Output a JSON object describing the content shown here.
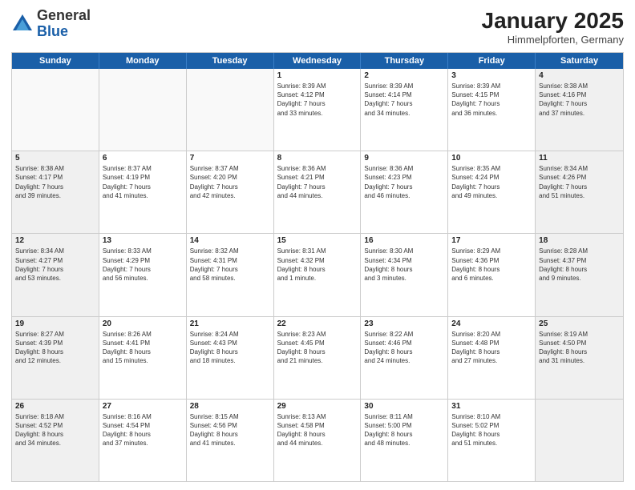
{
  "header": {
    "logo": {
      "general": "General",
      "blue": "Blue"
    },
    "title": "January 2025",
    "location": "Himmelpforten, Germany"
  },
  "weekdays": [
    "Sunday",
    "Monday",
    "Tuesday",
    "Wednesday",
    "Thursday",
    "Friday",
    "Saturday"
  ],
  "rows": [
    [
      {
        "day": "",
        "text": "",
        "empty": true
      },
      {
        "day": "",
        "text": "",
        "empty": true
      },
      {
        "day": "",
        "text": "",
        "empty": true
      },
      {
        "day": "1",
        "text": "Sunrise: 8:39 AM\nSunset: 4:12 PM\nDaylight: 7 hours\nand 33 minutes.",
        "empty": false
      },
      {
        "day": "2",
        "text": "Sunrise: 8:39 AM\nSunset: 4:14 PM\nDaylight: 7 hours\nand 34 minutes.",
        "empty": false
      },
      {
        "day": "3",
        "text": "Sunrise: 8:39 AM\nSunset: 4:15 PM\nDaylight: 7 hours\nand 36 minutes.",
        "empty": false
      },
      {
        "day": "4",
        "text": "Sunrise: 8:38 AM\nSunset: 4:16 PM\nDaylight: 7 hours\nand 37 minutes.",
        "empty": false,
        "shaded": true
      }
    ],
    [
      {
        "day": "5",
        "text": "Sunrise: 8:38 AM\nSunset: 4:17 PM\nDaylight: 7 hours\nand 39 minutes.",
        "empty": false,
        "shaded": true
      },
      {
        "day": "6",
        "text": "Sunrise: 8:37 AM\nSunset: 4:19 PM\nDaylight: 7 hours\nand 41 minutes.",
        "empty": false
      },
      {
        "day": "7",
        "text": "Sunrise: 8:37 AM\nSunset: 4:20 PM\nDaylight: 7 hours\nand 42 minutes.",
        "empty": false
      },
      {
        "day": "8",
        "text": "Sunrise: 8:36 AM\nSunset: 4:21 PM\nDaylight: 7 hours\nand 44 minutes.",
        "empty": false
      },
      {
        "day": "9",
        "text": "Sunrise: 8:36 AM\nSunset: 4:23 PM\nDaylight: 7 hours\nand 46 minutes.",
        "empty": false
      },
      {
        "day": "10",
        "text": "Sunrise: 8:35 AM\nSunset: 4:24 PM\nDaylight: 7 hours\nand 49 minutes.",
        "empty": false
      },
      {
        "day": "11",
        "text": "Sunrise: 8:34 AM\nSunset: 4:26 PM\nDaylight: 7 hours\nand 51 minutes.",
        "empty": false,
        "shaded": true
      }
    ],
    [
      {
        "day": "12",
        "text": "Sunrise: 8:34 AM\nSunset: 4:27 PM\nDaylight: 7 hours\nand 53 minutes.",
        "empty": false,
        "shaded": true
      },
      {
        "day": "13",
        "text": "Sunrise: 8:33 AM\nSunset: 4:29 PM\nDaylight: 7 hours\nand 56 minutes.",
        "empty": false
      },
      {
        "day": "14",
        "text": "Sunrise: 8:32 AM\nSunset: 4:31 PM\nDaylight: 7 hours\nand 58 minutes.",
        "empty": false
      },
      {
        "day": "15",
        "text": "Sunrise: 8:31 AM\nSunset: 4:32 PM\nDaylight: 8 hours\nand 1 minute.",
        "empty": false
      },
      {
        "day": "16",
        "text": "Sunrise: 8:30 AM\nSunset: 4:34 PM\nDaylight: 8 hours\nand 3 minutes.",
        "empty": false
      },
      {
        "day": "17",
        "text": "Sunrise: 8:29 AM\nSunset: 4:36 PM\nDaylight: 8 hours\nand 6 minutes.",
        "empty": false
      },
      {
        "day": "18",
        "text": "Sunrise: 8:28 AM\nSunset: 4:37 PM\nDaylight: 8 hours\nand 9 minutes.",
        "empty": false,
        "shaded": true
      }
    ],
    [
      {
        "day": "19",
        "text": "Sunrise: 8:27 AM\nSunset: 4:39 PM\nDaylight: 8 hours\nand 12 minutes.",
        "empty": false,
        "shaded": true
      },
      {
        "day": "20",
        "text": "Sunrise: 8:26 AM\nSunset: 4:41 PM\nDaylight: 8 hours\nand 15 minutes.",
        "empty": false
      },
      {
        "day": "21",
        "text": "Sunrise: 8:24 AM\nSunset: 4:43 PM\nDaylight: 8 hours\nand 18 minutes.",
        "empty": false
      },
      {
        "day": "22",
        "text": "Sunrise: 8:23 AM\nSunset: 4:45 PM\nDaylight: 8 hours\nand 21 minutes.",
        "empty": false
      },
      {
        "day": "23",
        "text": "Sunrise: 8:22 AM\nSunset: 4:46 PM\nDaylight: 8 hours\nand 24 minutes.",
        "empty": false
      },
      {
        "day": "24",
        "text": "Sunrise: 8:20 AM\nSunset: 4:48 PM\nDaylight: 8 hours\nand 27 minutes.",
        "empty": false
      },
      {
        "day": "25",
        "text": "Sunrise: 8:19 AM\nSunset: 4:50 PM\nDaylight: 8 hours\nand 31 minutes.",
        "empty": false,
        "shaded": true
      }
    ],
    [
      {
        "day": "26",
        "text": "Sunrise: 8:18 AM\nSunset: 4:52 PM\nDaylight: 8 hours\nand 34 minutes.",
        "empty": false,
        "shaded": true
      },
      {
        "day": "27",
        "text": "Sunrise: 8:16 AM\nSunset: 4:54 PM\nDaylight: 8 hours\nand 37 minutes.",
        "empty": false
      },
      {
        "day": "28",
        "text": "Sunrise: 8:15 AM\nSunset: 4:56 PM\nDaylight: 8 hours\nand 41 minutes.",
        "empty": false
      },
      {
        "day": "29",
        "text": "Sunrise: 8:13 AM\nSunset: 4:58 PM\nDaylight: 8 hours\nand 44 minutes.",
        "empty": false
      },
      {
        "day": "30",
        "text": "Sunrise: 8:11 AM\nSunset: 5:00 PM\nDaylight: 8 hours\nand 48 minutes.",
        "empty": false
      },
      {
        "day": "31",
        "text": "Sunrise: 8:10 AM\nSunset: 5:02 PM\nDaylight: 8 hours\nand 51 minutes.",
        "empty": false
      },
      {
        "day": "",
        "text": "",
        "empty": true,
        "shaded": true
      }
    ]
  ]
}
